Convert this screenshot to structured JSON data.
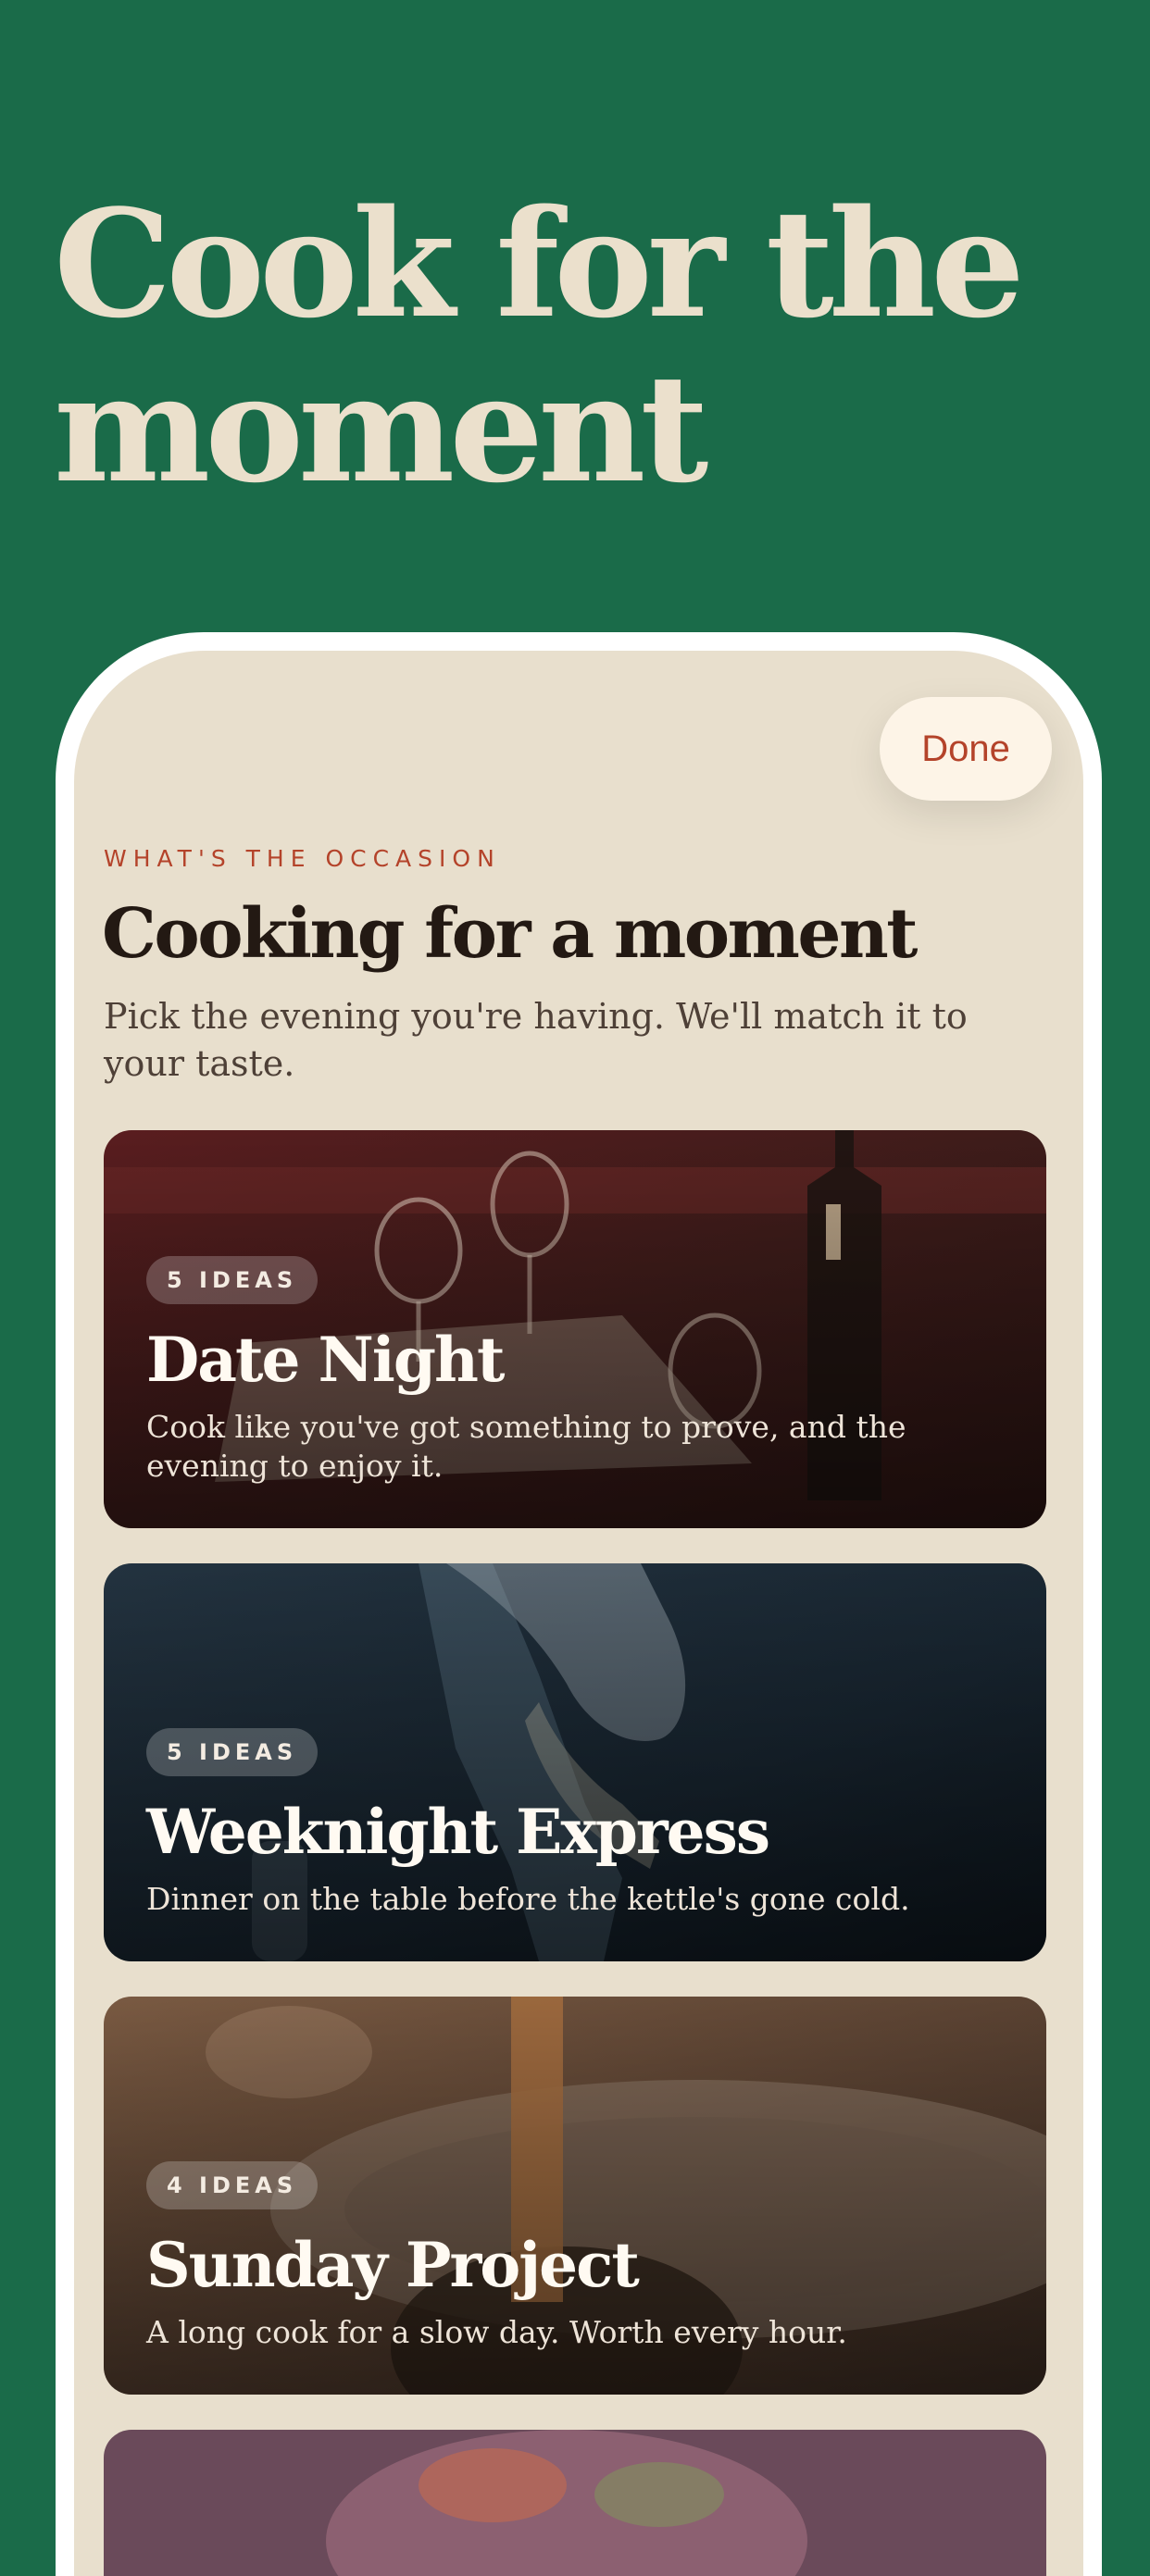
{
  "hero": {
    "title": "Cook for the moment"
  },
  "sheet": {
    "done_label": "Done",
    "eyebrow": "WHAT'S THE OCCASION",
    "title": "Cooking for a moment",
    "subtitle": "Pick the evening you're having. We'll match it to your taste."
  },
  "cards": [
    {
      "badge": "5 IDEAS",
      "title": "Date Night",
      "description": "Cook like you've got something to prove, and the evening to enjoy it."
    },
    {
      "badge": "5 IDEAS",
      "title": "Weeknight Express",
      "description": "Dinner on the table before the kettle's gone cold."
    },
    {
      "badge": "4 IDEAS",
      "title": "Sunday Project",
      "description": "A long cook for a slow day. Worth every hour."
    }
  ],
  "colors": {
    "background": "#1a6b49",
    "hero_text": "#ebe0cc",
    "sheet_background": "#e8dfcd",
    "accent": "#b4432a"
  }
}
